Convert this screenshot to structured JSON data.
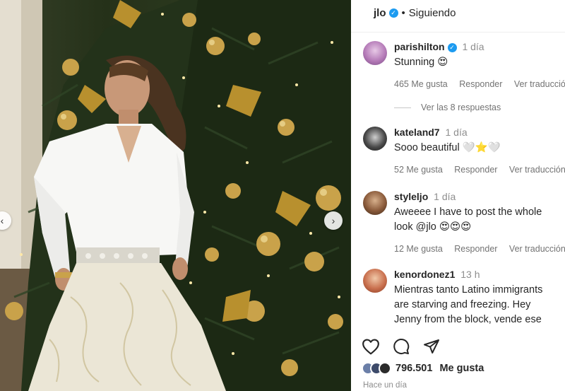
{
  "header": {
    "username": "jlo",
    "separator": "•",
    "follow_status": "Siguiendo"
  },
  "comments": [
    {
      "user": "parishilton",
      "verified": true,
      "time": "1 día",
      "text": "Stunning 😍",
      "likes": "465 Me gusta",
      "reply": "Responder",
      "translate": "Ver traducción"
    },
    {
      "replies_label": "Ver las 8 respuestas"
    },
    {
      "user": "kateland7",
      "verified": false,
      "time": "1 día",
      "text": "Sooo beautiful 🤍⭐🤍",
      "likes": "52 Me gusta",
      "reply": "Responder",
      "translate": "Ver traducción"
    },
    {
      "user": "styleljo",
      "verified": false,
      "time": "1 día",
      "text": "Aweeee I have to post the whole look @jlo 😍😍😍",
      "likes": "12 Me gusta",
      "reply": "Responder",
      "translate": "Ver traducción"
    },
    {
      "user": "kenordonez1",
      "verified": false,
      "time": "13 h",
      "text": "Mientras tanto Latino immigrants are starving and freezing. Hey Jenny from the block, vende ese par de",
      "likes": "",
      "reply": "",
      "translate": ""
    }
  ],
  "footer": {
    "likes_count": "796.501",
    "likes_label": "Me gusta",
    "posted_ago": "Hace un día"
  },
  "colors": {
    "verified": "#1d9bf0",
    "text": "#262626",
    "muted": "#737373"
  },
  "icons": [
    "heart-icon",
    "comment-icon",
    "share-icon",
    "verified-icon",
    "chevron-left-icon",
    "chevron-right-icon"
  ]
}
